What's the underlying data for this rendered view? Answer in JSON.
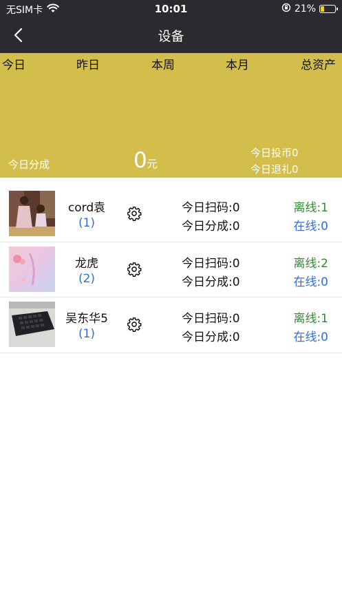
{
  "status_bar": {
    "carrier": "无SIM卡",
    "time": "10:01",
    "battery": "21%",
    "icons": [
      "wifi-icon",
      "orientation-lock-icon",
      "battery-icon"
    ]
  },
  "navbar": {
    "title": "设备",
    "back_icon": "chevron-left-icon"
  },
  "summary": {
    "tabs": [
      "今日",
      "昨日",
      "本周",
      "本月",
      "总资产"
    ],
    "label": "今日分成",
    "amount": "0",
    "unit": "元",
    "coin": "今日投币0",
    "gift": "今日退礼0"
  },
  "devices": [
    {
      "name": "cord袁",
      "count": "(1)",
      "scan": "今日扫码:0",
      "share": "今日分成:0",
      "offline": "离线:1",
      "online": "在线:0"
    },
    {
      "name": "龙虎",
      "count": "(2)",
      "scan": "今日扫码:0",
      "share": "今日分成:0",
      "offline": "离线:2",
      "online": "在线:0"
    },
    {
      "name": "吴东华5",
      "count": "(1)",
      "scan": "今日扫码:0",
      "share": "今日分成:0",
      "offline": "离线:1",
      "online": "在线:0"
    }
  ],
  "colors": {
    "header_bg": "#2b2b2f",
    "summary_bg": "#d3bd4b",
    "offline_green": "#2e8b2e",
    "online_blue": "#2f6fd6"
  }
}
